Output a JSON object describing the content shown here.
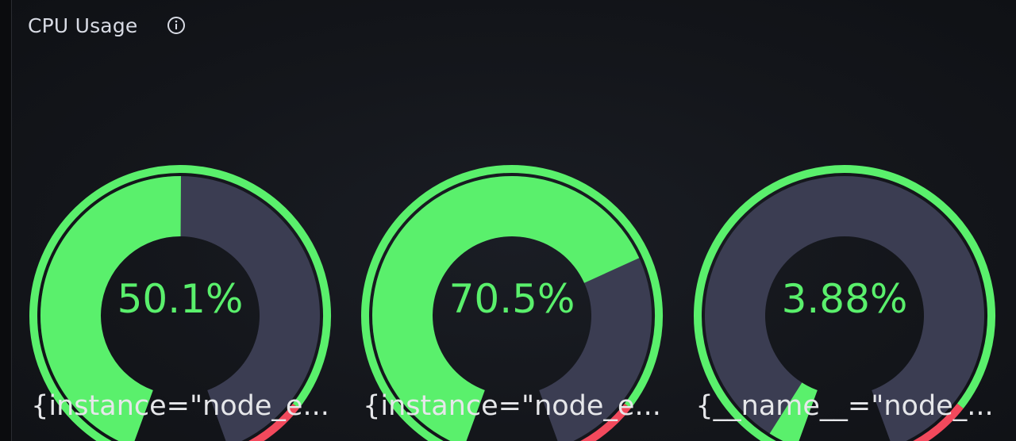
{
  "panel": {
    "title": "CPU Usage",
    "info_icon": "info-circle-icon"
  },
  "colors": {
    "green": "#5af06c",
    "red": "#f2495c",
    "track": "#3b3d52",
    "background": "#15171c",
    "value_text": "#5af06c"
  },
  "thresholds": {
    "min": 0,
    "max": 100,
    "red_from": 90
  },
  "gauges": [
    {
      "value": 50.1,
      "value_label": "50.1%",
      "legend": "{instance=\"node_e..."
    },
    {
      "value": 70.5,
      "value_label": "70.5%",
      "legend": "{instance=\"node_e..."
    },
    {
      "value": 3.88,
      "value_label": "3.88%",
      "legend": "{__name__=\"node_..."
    }
  ]
}
